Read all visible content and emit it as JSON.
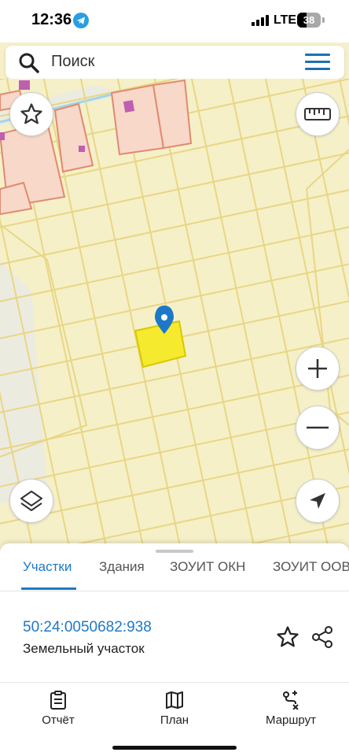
{
  "status_bar": {
    "time": "12:36",
    "network": "LTE",
    "battery": "38"
  },
  "search": {
    "placeholder": "Поиск"
  },
  "sheet": {
    "tabs": [
      {
        "label": "Участки"
      },
      {
        "label": "Здания"
      },
      {
        "label": "ЗОУИТ ОКН"
      },
      {
        "label": "ЗОУИТ ООВ"
      }
    ],
    "active_tab": "Участки",
    "parcel": {
      "number": "50:24:0050682:938",
      "type": "Земельный участок"
    }
  },
  "bottom_nav": [
    {
      "label": "Отчёт"
    },
    {
      "label": "План"
    },
    {
      "label": "Маршрут"
    }
  ],
  "colors": {
    "accent": "#1e78c8",
    "parcel_fill": "#f5f0c8",
    "parcel_line": "#e9d684",
    "selected_parcel": "#f5ea2e",
    "building_line": "#e08a70"
  }
}
